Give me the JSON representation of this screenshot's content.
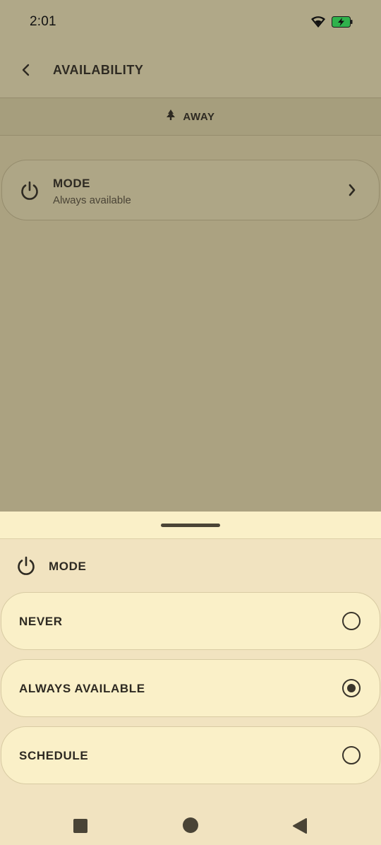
{
  "status_bar": {
    "time": "2:01",
    "icons": [
      "wifi-icon",
      "battery-charging-icon"
    ],
    "battery_color": "#2fb24c"
  },
  "app_bar": {
    "back_icon": "chevron-left-icon",
    "title": "AVAILABILITY"
  },
  "away_bar": {
    "icon": "tree-icon",
    "label": "AWAY"
  },
  "mode_card": {
    "icon": "power-icon",
    "title": "MODE",
    "subtitle": "Always available",
    "chevron_icon": "chevron-right-icon"
  },
  "sheet": {
    "icon": "power-icon",
    "title": "MODE",
    "options": [
      {
        "label": "NEVER",
        "selected": false
      },
      {
        "label": "ALWAYS AVAILABLE",
        "selected": true
      },
      {
        "label": "SCHEDULE",
        "selected": false
      }
    ]
  },
  "nav_bar": {
    "icons": [
      "recents-icon",
      "home-icon",
      "back-icon"
    ]
  },
  "colors": {
    "scrim_background": "#aba281",
    "sheet_background": "#f1e3c0",
    "option_background": "#faf0c8",
    "text": "#2e2a22"
  }
}
